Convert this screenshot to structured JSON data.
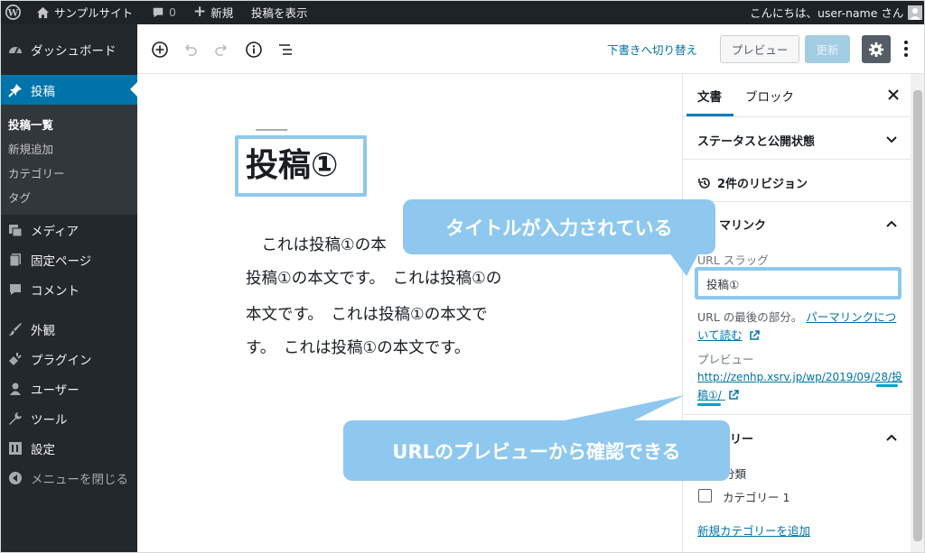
{
  "adminbar": {
    "site_name": "サンプルサイト",
    "comments_count": "0",
    "new_label": "新規",
    "view_post": "投稿を表示",
    "greeting": "こんにちは、user-name さん"
  },
  "menu": {
    "dashboard": "ダッシュボード",
    "posts": "投稿",
    "submenu": [
      "投稿一覧",
      "新規追加",
      "カテゴリー",
      "タグ"
    ],
    "media": "メディア",
    "pages": "固定ページ",
    "comments": "コメント",
    "appearance": "外観",
    "plugins": "プラグイン",
    "users": "ユーザー",
    "tools": "ツール",
    "settings": "設定",
    "collapse": "メニューを閉じる"
  },
  "toolbar": {
    "switch_to_draft": "下書きへ切り替え",
    "preview": "プレビュー",
    "update": "更新"
  },
  "editor": {
    "title": "投稿①",
    "paragraph_lines": [
      "　これは投稿①の本",
      "投稿①の本文です。　これは投稿①の",
      "本文です。　これは投稿①の本文で",
      "す。　これは投稿①の本文です。"
    ]
  },
  "sidebar": {
    "tab_document": "文書",
    "tab_block": "ブロック",
    "status_panel": "ステータスと公開状態",
    "revisions": "2件のリビジョン",
    "permalink_panel": "マリンク",
    "url_slug_label": "URL スラッグ",
    "url_slug_value": "投稿①",
    "help_prefix": "URL の最後の部分。",
    "help_link": "パーマリンクについて読む",
    "preview_label": "プレビュー",
    "preview_url": "http://zenhp.xsrv.jp/wp/2019/09/28/投稿①/",
    "categories_panel": "リー",
    "categories_sub": "分類",
    "category_item": "カテゴリー 1",
    "add_category": "新規カテゴリーを追加"
  },
  "callouts": {
    "title_note": "タイトルが入力されている",
    "url_note": "URLのプレビューから確認できる"
  },
  "colors": {
    "admin_dark": "#23282d",
    "admin_bar": "#1d2327",
    "accent_blue": "#0073aa",
    "callout": "#8ec8ee"
  }
}
